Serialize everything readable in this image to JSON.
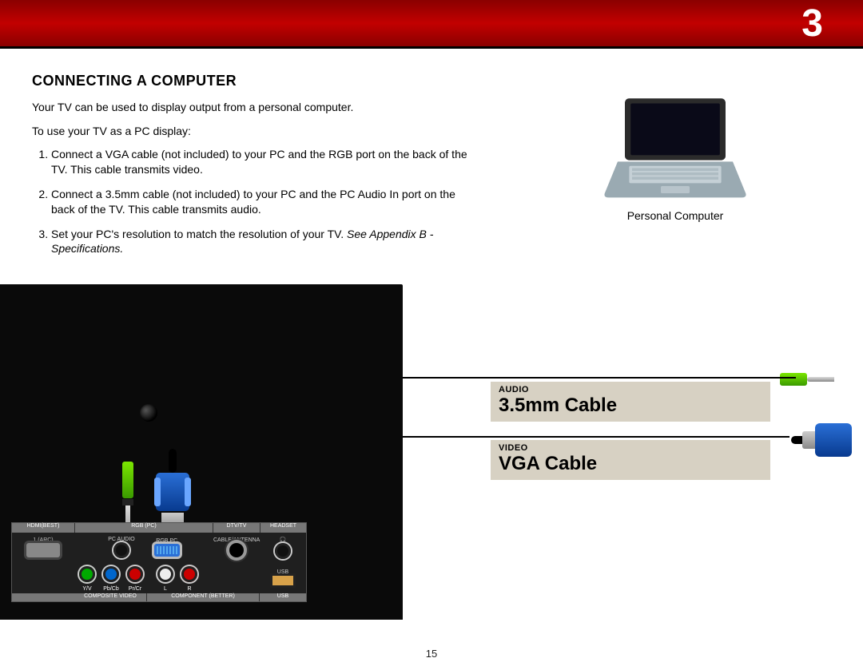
{
  "chapter_number": "3",
  "section_title": "CONNECTING A COMPUTER",
  "intro_text": "Your TV can be used to display output from a personal computer.",
  "lead_text": "To use your TV as a PC display:",
  "steps": [
    "Connect a VGA cable (not included) to your PC and the RGB port on the back of the TV. This cable transmits video.",
    "Connect a 3.5mm cable (not included) to your PC and the PC Audio In port on the back of the TV. This cable transmits audio.",
    "Set your PC's resolution to match the resolution of your TV. "
  ],
  "step3_appendix": "See Appendix B - Specifications.",
  "laptop_caption": "Personal Computer",
  "cable_audio": {
    "tag": "AUDIO",
    "name": "3.5mm Cable"
  },
  "cable_video": {
    "tag": "VIDEO",
    "name": "VGA Cable"
  },
  "port_labels": {
    "hdmi": "HDMI(BEST)",
    "hdmi_sub": "1 (ARC)",
    "rgb": "RGB (PC)",
    "pc_audio": "PC AUDIO",
    "rgb_pc": "RGB PC",
    "dtv": "DTV/TV",
    "cable": "CABLE/ANTENNA",
    "headset": "HEADSET",
    "headset_icon": "🎧",
    "usb": "USB",
    "comp_y": "Y/V",
    "comp_pb": "Pb/Cb",
    "comp_pr": "Pr/Cr",
    "audio_l": "L",
    "audio_r": "R",
    "composite": "COMPOSITE VIDEO",
    "component": "COMPONENT (BETTER)"
  },
  "page_number": "15",
  "colors": {
    "banner": "#a80000",
    "label_bar": "#d7d1c3",
    "audio_jack": "#66cc00",
    "vga_blue": "#1d5fc2"
  }
}
